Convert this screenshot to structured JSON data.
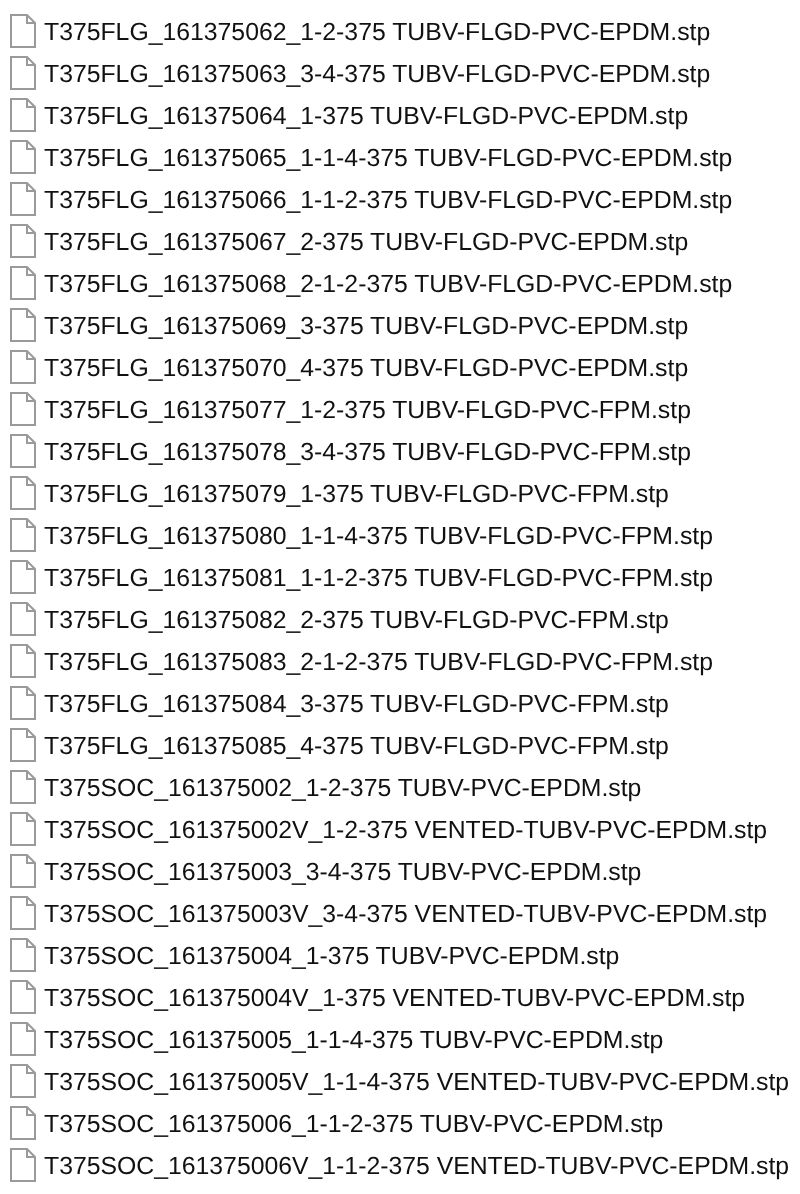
{
  "files": [
    {
      "name": "T375FLG_161375062_1-2-375 TUBV-FLGD-PVC-EPDM.stp"
    },
    {
      "name": "T375FLG_161375063_3-4-375 TUBV-FLGD-PVC-EPDM.stp"
    },
    {
      "name": "T375FLG_161375064_1-375 TUBV-FLGD-PVC-EPDM.stp"
    },
    {
      "name": "T375FLG_161375065_1-1-4-375 TUBV-FLGD-PVC-EPDM.stp"
    },
    {
      "name": "T375FLG_161375066_1-1-2-375 TUBV-FLGD-PVC-EPDM.stp"
    },
    {
      "name": "T375FLG_161375067_2-375 TUBV-FLGD-PVC-EPDM.stp"
    },
    {
      "name": "T375FLG_161375068_2-1-2-375 TUBV-FLGD-PVC-EPDM.stp"
    },
    {
      "name": "T375FLG_161375069_3-375 TUBV-FLGD-PVC-EPDM.stp"
    },
    {
      "name": "T375FLG_161375070_4-375 TUBV-FLGD-PVC-EPDM.stp"
    },
    {
      "name": "T375FLG_161375077_1-2-375 TUBV-FLGD-PVC-FPM.stp"
    },
    {
      "name": "T375FLG_161375078_3-4-375 TUBV-FLGD-PVC-FPM.stp"
    },
    {
      "name": "T375FLG_161375079_1-375 TUBV-FLGD-PVC-FPM.stp"
    },
    {
      "name": "T375FLG_161375080_1-1-4-375 TUBV-FLGD-PVC-FPM.stp"
    },
    {
      "name": "T375FLG_161375081_1-1-2-375 TUBV-FLGD-PVC-FPM.stp"
    },
    {
      "name": "T375FLG_161375082_2-375 TUBV-FLGD-PVC-FPM.stp"
    },
    {
      "name": "T375FLG_161375083_2-1-2-375 TUBV-FLGD-PVC-FPM.stp"
    },
    {
      "name": "T375FLG_161375084_3-375 TUBV-FLGD-PVC-FPM.stp"
    },
    {
      "name": "T375FLG_161375085_4-375 TUBV-FLGD-PVC-FPM.stp"
    },
    {
      "name": "T375SOC_161375002_1-2-375 TUBV-PVC-EPDM.stp"
    },
    {
      "name": "T375SOC_161375002V_1-2-375 VENTED-TUBV-PVC-EPDM.stp"
    },
    {
      "name": "T375SOC_161375003_3-4-375 TUBV-PVC-EPDM.stp"
    },
    {
      "name": "T375SOC_161375003V_3-4-375 VENTED-TUBV-PVC-EPDM.stp"
    },
    {
      "name": "T375SOC_161375004_1-375 TUBV-PVC-EPDM.stp"
    },
    {
      "name": "T375SOC_161375004V_1-375 VENTED-TUBV-PVC-EPDM.stp"
    },
    {
      "name": "T375SOC_161375005_1-1-4-375 TUBV-PVC-EPDM.stp"
    },
    {
      "name": "T375SOC_161375005V_1-1-4-375 VENTED-TUBV-PVC-EPDM.stp"
    },
    {
      "name": "T375SOC_161375006_1-1-2-375 TUBV-PVC-EPDM.stp"
    },
    {
      "name": "T375SOC_161375006V_1-1-2-375 VENTED-TUBV-PVC-EPDM.stp"
    }
  ]
}
